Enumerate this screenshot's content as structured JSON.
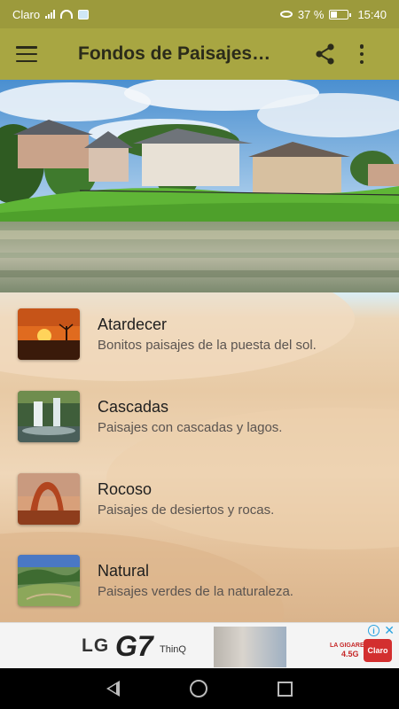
{
  "status_bar": {
    "carrier": "Claro",
    "battery": "37 %",
    "battery_level": 0.37,
    "time": "15:40",
    "icons": [
      "signal-icon",
      "wifi-icon",
      "shield-icon",
      "eye-icon",
      "battery-icon"
    ]
  },
  "app_bar": {
    "title": "Fondos de Paisajes…",
    "icons": [
      "menu-icon",
      "share-icon",
      "more-vert-icon"
    ]
  },
  "hero": {
    "description_icon": "landscape-header-image"
  },
  "categories": [
    {
      "title": "Atardecer",
      "subtitle": "Bonitos paisajes de la puesta del sol.",
      "thumbnail": "sunset-thumbnail"
    },
    {
      "title": "Cascadas",
      "subtitle": "Paisajes con cascadas y lagos.",
      "thumbnail": "waterfall-thumbnail"
    },
    {
      "title": "Rocoso",
      "subtitle": "Paisajes de desiertos y rocas.",
      "thumbnail": "rock-arch-thumbnail"
    },
    {
      "title": "Natural",
      "subtitle": "Paisajes verdes de la naturaleza.",
      "thumbnail": "green-valley-thumbnail"
    }
  ],
  "ad_banner": {
    "brand": "LG",
    "model": "G7",
    "model_suffix": "ThinQ",
    "offer_brand": "LA GIGARED",
    "offer_price": "4.5G",
    "carrier_logo": "Claro",
    "info_label": "i",
    "close_label": "✕"
  },
  "colors": {
    "status_bar": "#9c9a3c",
    "app_bar": "#a8a642",
    "title_text": "#2b2b1a"
  }
}
